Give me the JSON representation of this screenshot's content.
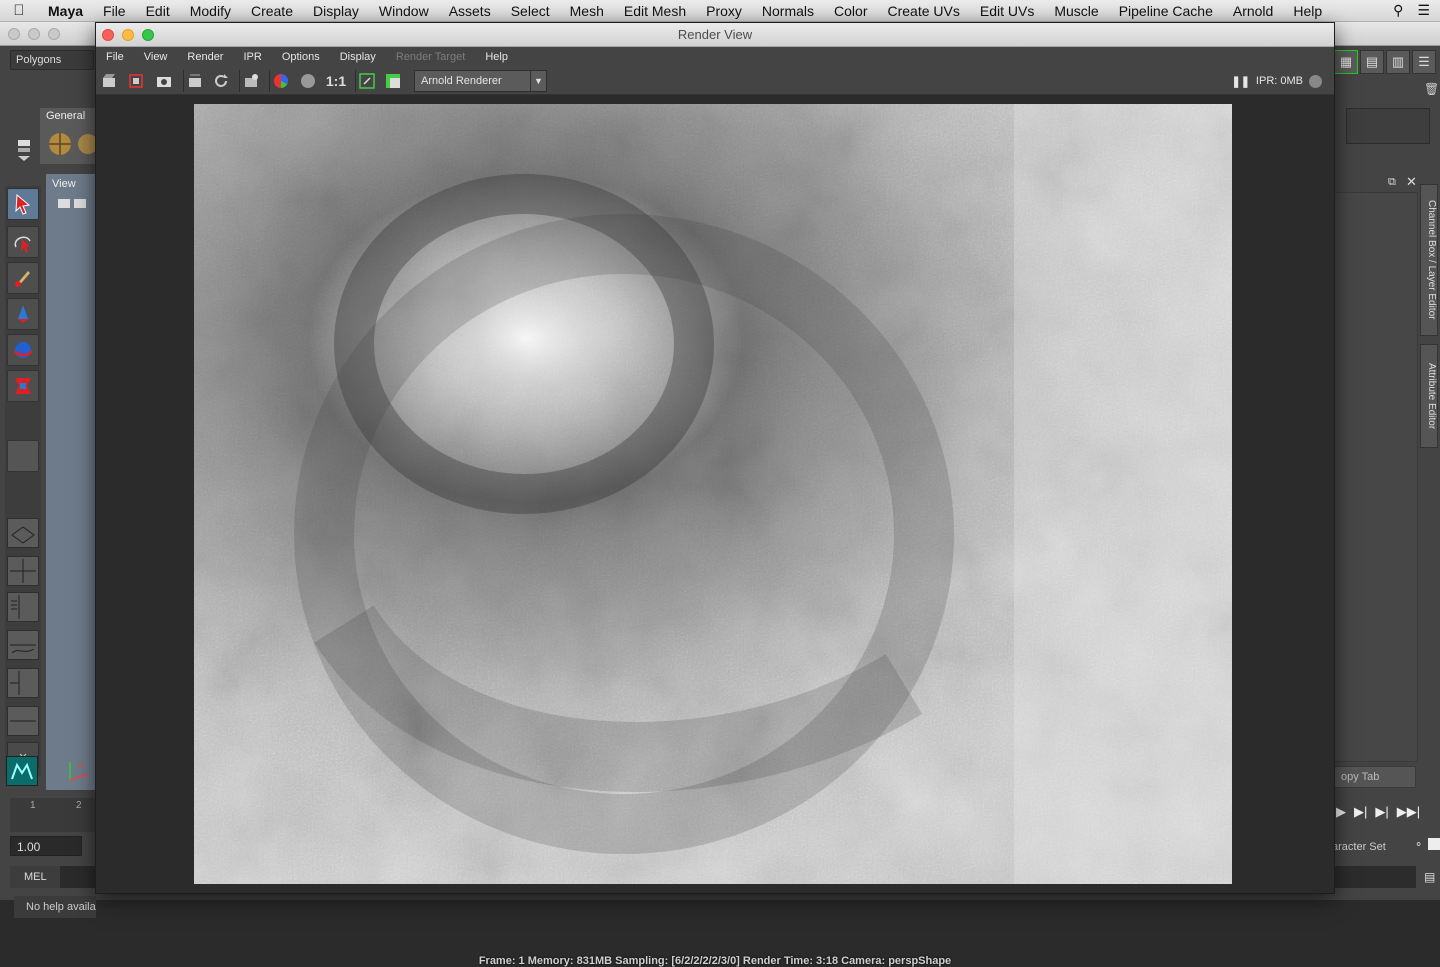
{
  "menubar": {
    "app_name": "Maya",
    "items": [
      "File",
      "Edit",
      "Modify",
      "Create",
      "Display",
      "Window",
      "Assets",
      "Select",
      "Mesh",
      "Edit Mesh",
      "Proxy",
      "Normals",
      "Color",
      "Create UVs",
      "Edit UVs",
      "Muscle",
      "Pipeline Cache",
      "Arnold",
      "Help"
    ]
  },
  "left_panel": {
    "menu_set": "Polygons",
    "shelf_tab": "General",
    "view_label": "View",
    "frame_value": "1.00",
    "mel_label": "MEL",
    "help_line": "No help availa",
    "timeline_ticks": [
      "1",
      "2"
    ]
  },
  "right_panel": {
    "vertical_tabs": [
      "Channel Box / Layer Editor",
      "Attribute Editor"
    ],
    "copy_tab": "opy Tab",
    "character_set": "aracter Set"
  },
  "render_view": {
    "title": "Render View",
    "menu": [
      "File",
      "View",
      "Render",
      "IPR",
      "Options",
      "Display",
      "Render Target",
      "Help"
    ],
    "disabled_menu": [
      "Render Target"
    ],
    "ratio_label": "1:1",
    "renderer": "Arnold Renderer",
    "ipr_status": "IPR: 0MB",
    "status_line": "Frame: 1    Memory: 831MB    Sampling: [6/2/2/2/2/3/0]    Render Time: 3:18    Camera: perspShape"
  },
  "colors": {
    "panel_bg": "#444444",
    "viewport_bg": "#6e7b8a",
    "close": "#fc605c",
    "minimize": "#fdbc40",
    "zoom": "#34c84a",
    "select_tool": "#5e7a96"
  }
}
